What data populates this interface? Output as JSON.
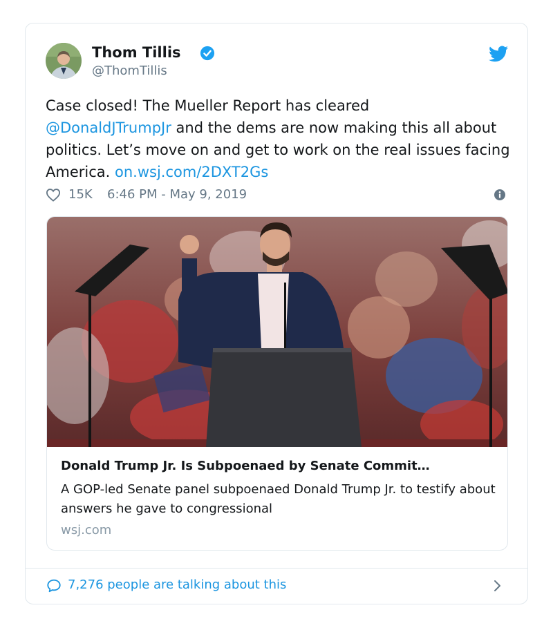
{
  "tweet": {
    "author_name": "Thom Tillis",
    "handle": "@ThomTillis",
    "text_part1": "Case closed! The Mueller Report has cleared",
    "mention": "@DonaldJTrumpJr",
    "text_part2": "  and the dems are now making this all about politics. Let’s move on and get to work on the real issues facing America.",
    "url": "on.wsj.com/2DXT2Gs",
    "likes": "15K",
    "timestamp": "6:46 PM - May 9, 2019"
  },
  "link_card": {
    "title": "Donald Trump Jr. Is Subpoenaed by Senate Commit…",
    "description": "A GOP-led Senate panel subpoenaed Donald Trump Jr. to testify about answers he gave to congressional",
    "domain": "wsj.com"
  },
  "footer": {
    "talking": "7,276 people are talking about this"
  },
  "colors": {
    "link": "#1b95e0",
    "secondary_text": "#657786",
    "border": "#e1e8ed"
  },
  "icons": [
    "verified-badge-icon",
    "twitter-bird-icon",
    "heart-icon",
    "info-icon",
    "comment-bubble-icon",
    "chevron-right-icon"
  ]
}
